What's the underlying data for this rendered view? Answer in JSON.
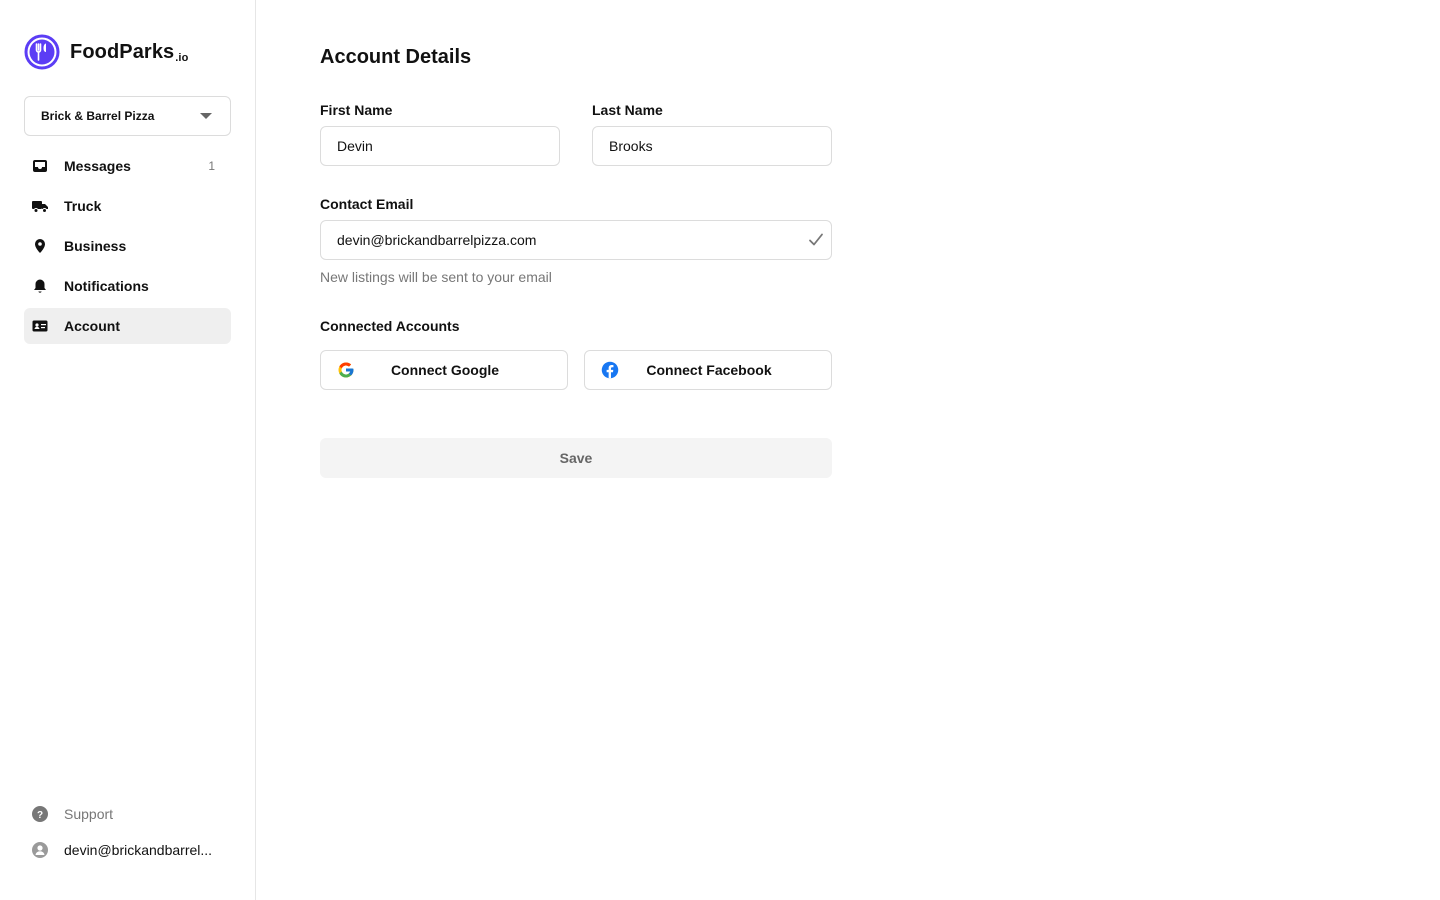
{
  "brand": {
    "name": "FoodParks",
    "suffix": ".io",
    "icon": "fork-knife-logo",
    "color": "#5b3df5"
  },
  "business_select": {
    "value": "Brick & Barrel Pizza",
    "icon": "chevron-down-icon"
  },
  "nav": {
    "items": [
      {
        "label": "Messages",
        "icon": "inbox-icon",
        "count": "1"
      },
      {
        "label": "Truck",
        "icon": "truck-icon",
        "count": ""
      },
      {
        "label": "Business",
        "icon": "location-pin-icon",
        "count": ""
      },
      {
        "label": "Notifications",
        "icon": "bell-icon",
        "count": ""
      },
      {
        "label": "Account",
        "icon": "id-card-icon",
        "count": "",
        "active": true
      }
    ]
  },
  "bottom_nav": {
    "support": {
      "label": "Support",
      "icon": "help-icon"
    },
    "user": {
      "label": "devin@brickandbarrel...",
      "icon": "user-avatar-icon"
    }
  },
  "main": {
    "title": "Account Details",
    "first_name": {
      "label": "First Name",
      "value": "Devin"
    },
    "last_name": {
      "label": "Last Name",
      "value": "Brooks"
    },
    "email": {
      "label": "Contact Email",
      "value": "devin@brickandbarrelpizza.com",
      "help": "New listings will be sent to your email",
      "icon": "check-icon"
    },
    "connected": {
      "label": "Connected Accounts",
      "google": {
        "label": "Connect Google",
        "icon": "google-icon"
      },
      "facebook": {
        "label": "Connect Facebook",
        "icon": "facebook-icon",
        "color": "#1877f2"
      }
    },
    "save_label": "Save"
  }
}
